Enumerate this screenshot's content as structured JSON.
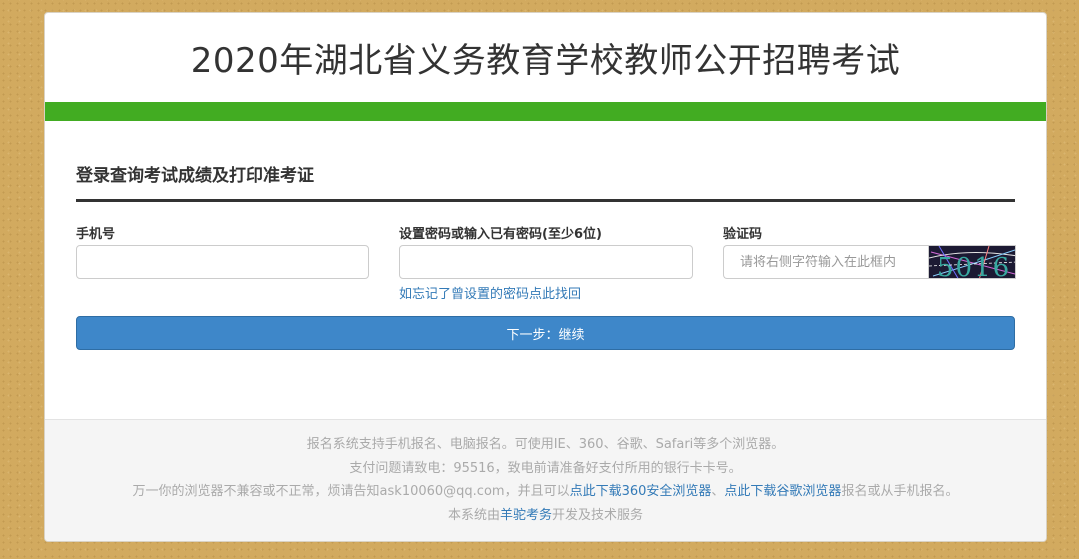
{
  "header": {
    "title": "2020年湖北省义务教育学校教师公开招聘考试"
  },
  "form": {
    "section_title": "登录查询考试成绩及打印准考证",
    "phone_label": "手机号",
    "phone_value": "",
    "password_label": "设置密码或输入已有密码(至少6位)",
    "password_value": "",
    "forgot_link": "如忘记了曾设置的密码点此找回",
    "captcha_label": "验证码",
    "captcha_placeholder": "请将右侧字符输入在此框内",
    "captcha_value": "",
    "captcha_image_text": "5016",
    "next_button": "下一步：继续"
  },
  "footer": {
    "line1": "报名系统支持手机报名、电脑报名。可使用IE、360、谷歌、Safari等多个浏览器。",
    "line2": "支付问题请致电：95516，致电前请准备好支付所用的银行卡卡号。",
    "line3_prefix": "万一你的浏览器不兼容或不正常，烦请告知ask10060@qq.com，并且可以",
    "line3_link1": "点此下载360安全浏览器",
    "line3_sep": "、",
    "line3_link2": "点此下载谷歌浏览器",
    "line3_suffix": "报名或从手机报名。",
    "line4_prefix": "本系统由",
    "line4_link": "羊驼考务",
    "line4_suffix": "开发及技术服务"
  },
  "colors": {
    "accent_green": "#42ac22",
    "button_blue": "#3e87c9",
    "link_blue": "#337ab7"
  }
}
